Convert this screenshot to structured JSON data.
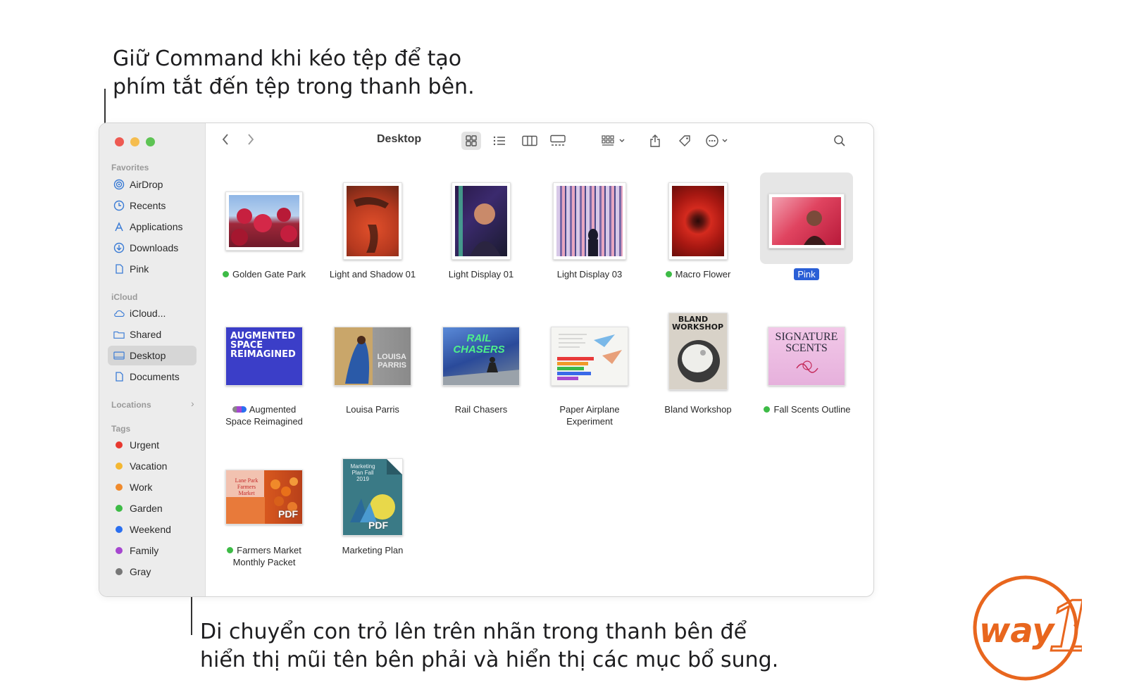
{
  "callouts": {
    "top_line1": "Giữ Command khi kéo tệp để tạo",
    "top_line2": "phím tắt đến tệp trong thanh bên.",
    "bottom_line1": "Di chuyển con trỏ lên trên nhãn trong thanh bên để",
    "bottom_line2": "hiển thị mũi tên bên phải và hiển thị các mục bổ sung."
  },
  "window": {
    "title": "Desktop"
  },
  "sidebar": {
    "favorites_title": "Favorites",
    "favorites": [
      {
        "label": "AirDrop",
        "icon": "airdrop-icon"
      },
      {
        "label": "Recents",
        "icon": "clock-icon"
      },
      {
        "label": "Applications",
        "icon": "applications-icon"
      },
      {
        "label": "Downloads",
        "icon": "download-icon"
      },
      {
        "label": "Pink",
        "icon": "document-icon"
      }
    ],
    "icloud_title": "iCloud",
    "icloud": [
      {
        "label": "iCloud...",
        "icon": "cloud-icon"
      },
      {
        "label": "Shared",
        "icon": "shared-folder-icon"
      },
      {
        "label": "Desktop",
        "icon": "desktop-icon",
        "active": true
      },
      {
        "label": "Documents",
        "icon": "document-icon"
      }
    ],
    "locations_title": "Locations",
    "tags_title": "Tags",
    "tags": [
      {
        "label": "Urgent",
        "color": "#e8382f"
      },
      {
        "label": "Vacation",
        "color": "#f4b731"
      },
      {
        "label": "Work",
        "color": "#f08a2c"
      },
      {
        "label": "Garden",
        "color": "#3dbb46"
      },
      {
        "label": "Weekend",
        "color": "#2a6ff0"
      },
      {
        "label": "Family",
        "color": "#a646d0"
      },
      {
        "label": "Gray",
        "color": "#777777"
      }
    ]
  },
  "files": [
    {
      "label1": "Golden Gate Park",
      "label2": "",
      "tag": "#3dbb46"
    },
    {
      "label1": "Light and Shadow 01",
      "label2": "",
      "tag": ""
    },
    {
      "label1": "Light Display 01",
      "label2": "",
      "tag": ""
    },
    {
      "label1": "Light Display 03",
      "label2": "",
      "tag": ""
    },
    {
      "label1": "Macro Flower",
      "label2": "",
      "tag": "#3dbb46"
    },
    {
      "label1": "Pink",
      "label2": "",
      "tag": "",
      "selected": true
    },
    {
      "label1": "Augmented",
      "label2": "Space Reimagined",
      "tag": "multi"
    },
    {
      "label1": "Louisa Parris",
      "label2": "",
      "tag": ""
    },
    {
      "label1": "Rail Chasers",
      "label2": "",
      "tag": ""
    },
    {
      "label1": "Paper Airplane",
      "label2": "Experiment",
      "tag": ""
    },
    {
      "label1": "Bland Workshop",
      "label2": "",
      "tag": ""
    },
    {
      "label1": "Fall Scents Outline",
      "label2": "",
      "tag": "#3dbb46"
    },
    {
      "label1": "Farmers Market",
      "label2": "Monthly Packet",
      "tag": "#3dbb46"
    },
    {
      "label1": "Marketing Plan",
      "label2": "",
      "tag": ""
    }
  ],
  "thumb_text": {
    "augmented": "AUGMENTED SPACE REIMAGINED",
    "louisa": "LOUISA PARRIS",
    "rail": "RAIL CHASERS",
    "bland": "BLAND WORKSHOP",
    "signature": "SIGNATURE SCENTS",
    "farmers": "Lane Park Farmers Market",
    "marketing": "Marketing Plan Fall 2019",
    "pdf": "PDF"
  },
  "logo": {
    "text": "way",
    "digit": "1"
  }
}
